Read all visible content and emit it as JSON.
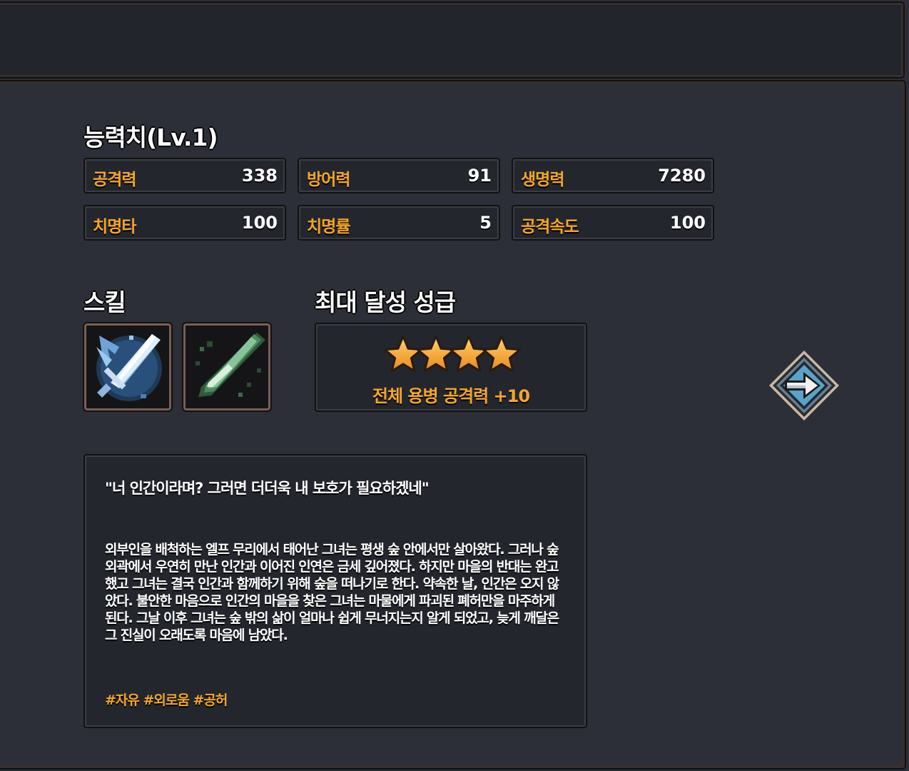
{
  "stats": {
    "title": "능력치(Lv.1)",
    "items": [
      {
        "label": "공격력",
        "value": "338"
      },
      {
        "label": "방어력",
        "value": "91"
      },
      {
        "label": "생명력",
        "value": "7280"
      },
      {
        "label": "치명타",
        "value": "100"
      },
      {
        "label": "치명률",
        "value": "5"
      },
      {
        "label": "공격속도",
        "value": "100"
      }
    ]
  },
  "skills": {
    "title": "스킬",
    "items": [
      {
        "icon": "ice-sword-skill-icon"
      },
      {
        "icon": "green-slash-skill-icon"
      }
    ]
  },
  "grade": {
    "title": "최대 달성 성급",
    "stars": 4,
    "bonus": "전체 용병 공격력 +10"
  },
  "description": {
    "quote": "\"너 인간이라며? 그러면 더더욱 내 보호가 필요하겠네\"",
    "story": "외부인을 배척하는 엘프 무리에서 태어난 그녀는 평생 숲 안에서만 살아왔다. 그러나 숲 외곽에서 우연히 만난 인간과 이어진 인연은 금세 깊어졌다. 하지만 마을의 반대는 완고했고 그녀는 결국 인간과 함께하기 위해 숲을 떠나기로 한다. 약속한 날, 인간은 오지 않았다. 불안한 마음으로 인간의 마을을 찾은 그녀는 마물에게 파괴된 폐허만을 마주하게 된다. 그날 이후 그녀는 숲 밖의 삶이 얼마나 쉽게 무너지는지 알게 되었고, 늦게 깨달은 그 진실이 오래도록 마음에 남았다.",
    "tags": "#자유 #외로움 #공허"
  },
  "navigation": {
    "next_icon": "right-arrow-icon"
  },
  "colors": {
    "accent": "#f4a62a",
    "panel": "#2c2f37",
    "box": "#23262d"
  }
}
